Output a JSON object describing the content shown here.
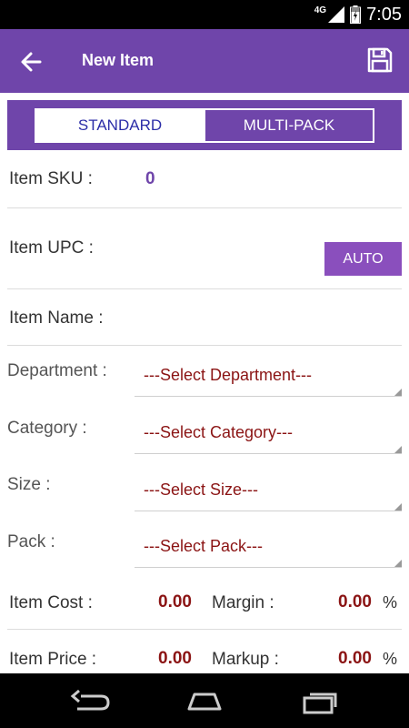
{
  "status_bar": {
    "network": "4G",
    "time": "7:05",
    "icons": [
      "signal-icon",
      "battery-icon"
    ]
  },
  "app_bar": {
    "title": "New Item",
    "back_icon": "arrow-left-icon",
    "save_icon": "floppy-disk-icon",
    "color": "#6f45aa"
  },
  "segment": {
    "standard": "STANDARD",
    "multipack": "MULTI-PACK",
    "selected": "STANDARD"
  },
  "form": {
    "sku": {
      "label": "Item SKU :",
      "value": "0"
    },
    "upc": {
      "label": "Item UPC :",
      "auto_button": "AUTO"
    },
    "name": {
      "label": "Item Name :"
    },
    "department": {
      "label": "Department :",
      "value": "---Select Department---"
    },
    "category": {
      "label": "Category :",
      "value": "---Select Category---"
    },
    "size": {
      "label": "Size :",
      "value": "---Select Size---"
    },
    "pack": {
      "label": "Pack :",
      "value": "---Select Pack---"
    },
    "cost": {
      "label": "Item Cost :",
      "value": "0.00"
    },
    "margin": {
      "label": "Margin :",
      "value": "0.00",
      "unit": "%"
    },
    "price": {
      "label": "Item Price :",
      "value": "0.00"
    },
    "markup": {
      "label": "Markup :",
      "value": "0.00",
      "unit": "%"
    }
  },
  "nav_bar": {
    "icons": [
      "back-nav-icon",
      "home-nav-icon",
      "recents-nav-icon"
    ]
  }
}
